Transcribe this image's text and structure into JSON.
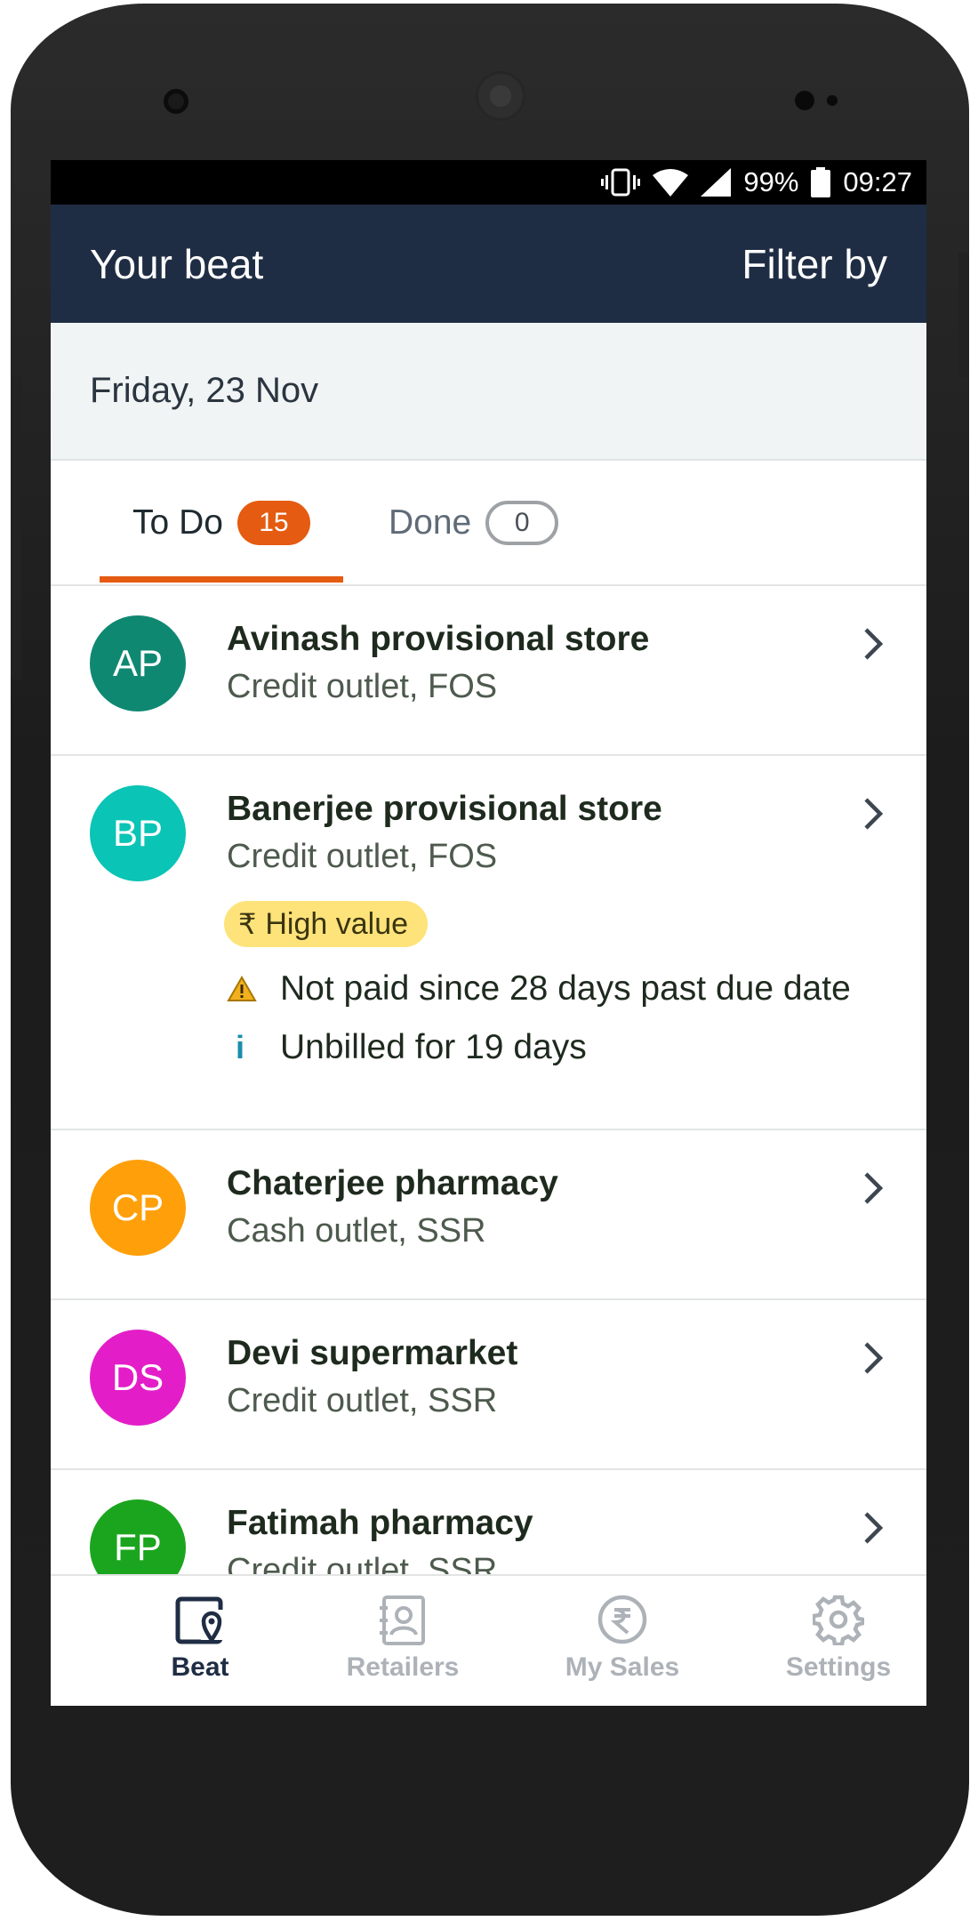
{
  "status": {
    "battery": "99%",
    "time": "09:27"
  },
  "header": {
    "title": "Your beat",
    "filter_label": "Filter by"
  },
  "date_label": "Friday, 23 Nov",
  "tabs": [
    {
      "label": "To Do",
      "count": "15"
    },
    {
      "label": "Done",
      "count": "0"
    }
  ],
  "retailers": [
    {
      "initials": "AP",
      "name": "Avinash provisional store",
      "type": "Credit outlet, FOS",
      "color": "#0f8872"
    },
    {
      "initials": "BP",
      "name": "Banerjee provisional store",
      "type": "Credit outlet, FOS",
      "color": "#0ac4b5",
      "tag": "High value",
      "tag_symbol": "₹",
      "alerts": [
        {
          "icon": "warning-icon",
          "text": "Not paid since 28 days past due date"
        },
        {
          "icon": "info-icon",
          "text": "Unbilled for 19 days"
        }
      ]
    },
    {
      "initials": "CP",
      "name": "Chaterjee pharmacy",
      "type": "Cash outlet, SSR",
      "color": "#ff9f0a"
    },
    {
      "initials": "DS",
      "name": "Devi supermarket",
      "type": "Credit outlet, SSR",
      "color": "#e31ec8"
    },
    {
      "initials": "FP",
      "name": "Fatimah pharmacy",
      "type": "Credit outlet, SSR",
      "color": "#1ba51e"
    }
  ],
  "nav": [
    {
      "label": "Beat",
      "icon": "beat-icon",
      "active": true
    },
    {
      "label": "Retailers",
      "icon": "contacts-icon",
      "active": false
    },
    {
      "label": "My Sales",
      "icon": "rupee-circle-icon",
      "active": false
    },
    {
      "label": "Settings",
      "icon": "gear-icon",
      "active": false
    }
  ]
}
